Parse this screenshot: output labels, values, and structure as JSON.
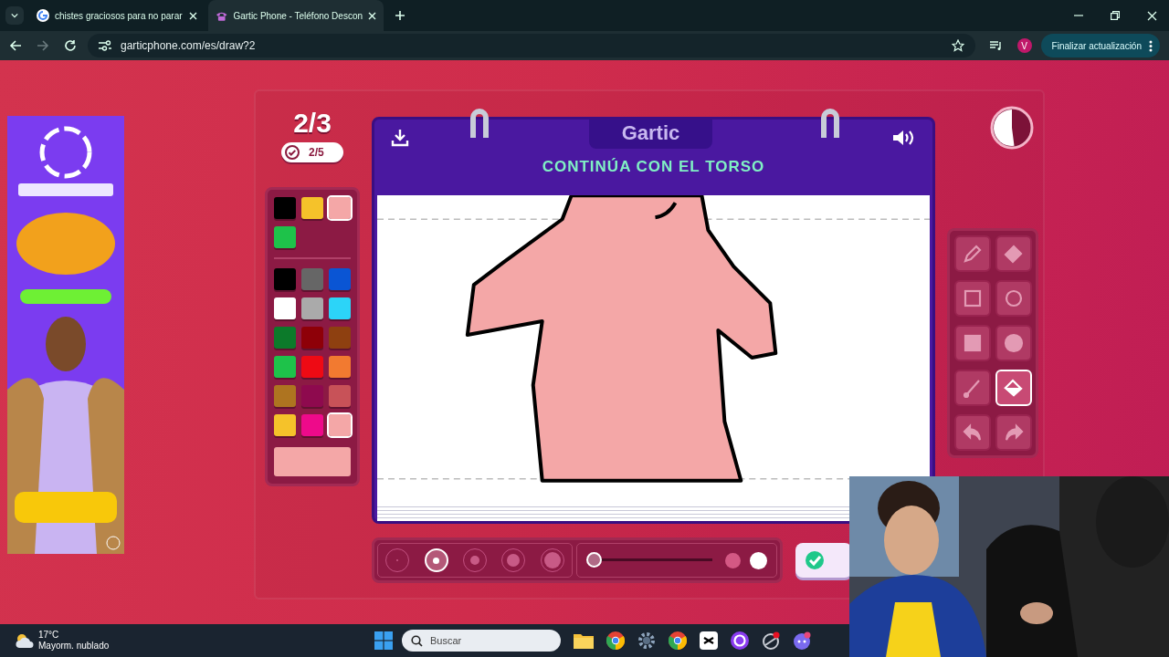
{
  "browser": {
    "tabs": [
      {
        "title": "chistes graciosos para no parar",
        "selected": false
      },
      {
        "title": "Gartic Phone - Teléfono Descon",
        "selected": true
      }
    ],
    "address": "garticphone.com/es/draw?2",
    "profile": "V",
    "update_button": "Finalizar actualización"
  },
  "game": {
    "round": "2/3",
    "done_count": "2/5",
    "palette": {
      "recent": [
        {
          "color": "#000000",
          "selected": false
        },
        {
          "color": "#f5c22a",
          "selected": false
        },
        {
          "color": "#f4a7a7",
          "selected": true
        },
        {
          "color": "#1ec24a",
          "selected": false
        }
      ],
      "colors": [
        {
          "color": "#000000",
          "selected": false
        },
        {
          "color": "#666666",
          "selected": false
        },
        {
          "color": "#0a55d4",
          "selected": false
        },
        {
          "color": "#ffffff",
          "selected": false
        },
        {
          "color": "#aaaaaa",
          "selected": false
        },
        {
          "color": "#2cd4f8",
          "selected": false
        },
        {
          "color": "#0c7a2a",
          "selected": false
        },
        {
          "color": "#8e0008",
          "selected": false
        },
        {
          "color": "#8e4010",
          "selected": false
        },
        {
          "color": "#1ec24a",
          "selected": false
        },
        {
          "color": "#ee0a14",
          "selected": false
        },
        {
          "color": "#f27a30",
          "selected": false
        },
        {
          "color": "#ae7420",
          "selected": false
        },
        {
          "color": "#8e0a4e",
          "selected": false
        },
        {
          "color": "#c85258",
          "selected": false
        },
        {
          "color": "#f5c22a",
          "selected": false
        },
        {
          "color": "#ee0a8a",
          "selected": false
        },
        {
          "color": "#f4a7a7",
          "selected": true
        }
      ]
    },
    "notepad": {
      "logo": "Gartic",
      "instruction": "CONTINÚA CON EL TORSO"
    },
    "timer": {
      "level": 0.52
    },
    "tools": [
      {
        "kind": "pencil",
        "selected": false
      },
      {
        "kind": "eraser",
        "selected": false
      },
      {
        "kind": "square",
        "selected": false
      },
      {
        "kind": "circle",
        "selected": false
      },
      {
        "kind": "filled-square",
        "selected": false
      },
      {
        "kind": "filled-circle",
        "selected": false
      },
      {
        "kind": "line",
        "selected": false
      },
      {
        "kind": "bucket",
        "selected": true
      },
      {
        "kind": "undo",
        "selected": false
      },
      {
        "kind": "redo",
        "selected": false
      }
    ],
    "brush_sizes": [
      {
        "selected": false
      },
      {
        "selected": true
      },
      {
        "selected": false
      },
      {
        "selected": false
      },
      {
        "selected": false
      }
    ],
    "opacity": {
      "level": 0
    }
  },
  "taskbar": {
    "temperature": "17°C",
    "weather": "Mayorm. nublado",
    "search_placeholder": "Buscar"
  }
}
